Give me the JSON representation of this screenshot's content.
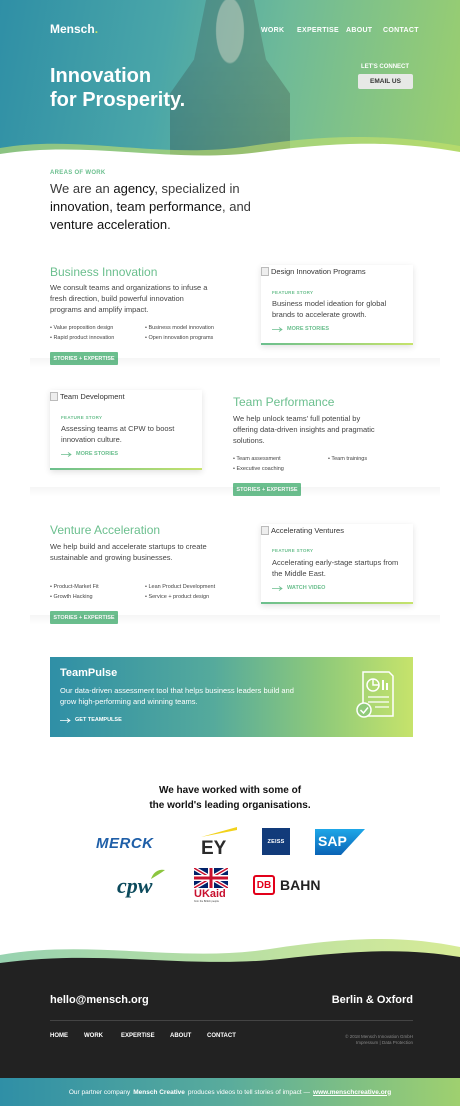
{
  "header": {
    "logo": "Mensch",
    "logo_dot": ".",
    "nav": [
      "WORK",
      "EXPERTISE",
      "ABOUT",
      "CONTACT"
    ],
    "title_line1": "Innovation",
    "title_line2": "for Prosperity.",
    "connect_label": "LET'S CONNECT",
    "email_button": "EMAIL US"
  },
  "intro": {
    "eyebrow": "AREAS OF WORK",
    "line_a": "We are an ",
    "line_b": "agency",
    "line_c": ", specialized in",
    "line_d": "innovation, team performance",
    "line_e": ", and",
    "line_f": "venture acceleration",
    "line_g": "."
  },
  "sections": [
    {
      "title": "Business Innovation",
      "text": "We consult teams and organizations to infuse a fresh direction, build powerful innovation programs and amplify impact.",
      "bullets_left": [
        "Value proposition design",
        "Rapid product innovation"
      ],
      "bullets_right": [
        "Business model innovation",
        "Open innovation programs"
      ],
      "tag": "STORIES + EXPERTISE",
      "card": {
        "image_alt": "Design Innovation Programs",
        "eyebrow": "FEATURE STORY",
        "text": "Business model ideation for global brands to accelerate growth.",
        "link": "MORE STORIES"
      }
    },
    {
      "title": "Team Performance",
      "text": "We help unlock teams' full potential by offering data-driven insights and pragmatic solutions.",
      "bullets_left": [
        "Team assessment",
        "Executive coaching"
      ],
      "bullets_right": [
        "Team trainings"
      ],
      "tag": "STORIES + EXPERTISE",
      "card": {
        "image_alt": "Team Development",
        "eyebrow": "FEATURE STORY",
        "text": "Assessing teams at CPW to boost innovation culture.",
        "link": "MORE STORIES"
      }
    },
    {
      "title": "Venture Acceleration",
      "text": "We help build and accelerate startups to create sustainable and growing businesses.",
      "bullets_left": [
        "Product-Market Fit",
        "Growth Hacking"
      ],
      "bullets_right": [
        "Lean Product Development",
        "Service + product design"
      ],
      "tag": "STORIES + EXPERTISE",
      "card": {
        "image_alt": "Accelerating Ventures",
        "eyebrow": "FEATURE STORY",
        "text": "Accelerating early-stage startups from the Middle East.",
        "link": "WATCH VIDEO"
      }
    }
  ],
  "teampulse": {
    "title": "TeamPulse",
    "text": "Our data-driven assessment tool that helps business leaders build and grow high-performing and winning teams.",
    "link": "GET TEAMPULSE",
    "icon": "report-chart-icon"
  },
  "clients": {
    "title_line1": "We have worked with some of",
    "title_line2": "the world's leading organisations.",
    "logos": {
      "merck": "MERCK",
      "ey": "EY",
      "zeiss": "ZEISS",
      "sap": "SAP",
      "cpw": "cpw",
      "ukaid": "UKaid",
      "ukaid_small": "from the British people",
      "db": "DB",
      "bahn": "BAHN"
    }
  },
  "footer": {
    "email": "hello@mensch.org",
    "cities": "Berlin & Oxford",
    "nav": [
      "HOME",
      "WORK",
      "EXPERTISE",
      "ABOUT",
      "CONTACT"
    ],
    "copyright_line1": "© 2018 Mensch Innovation GmbH",
    "copyright_line2": "Impressum | Data Protection"
  },
  "partner": {
    "prefix": "Our partner company",
    "company": "Mensch Creative",
    "middle": "produces videos to tell stories of impact —",
    "link": "www.menschcreative.org"
  },
  "colors": {
    "accent_green": "#6bbf8e",
    "accent_lime": "#c6e36b",
    "accent_teal": "#2f8fa6",
    "footer_bg": "#222222"
  }
}
